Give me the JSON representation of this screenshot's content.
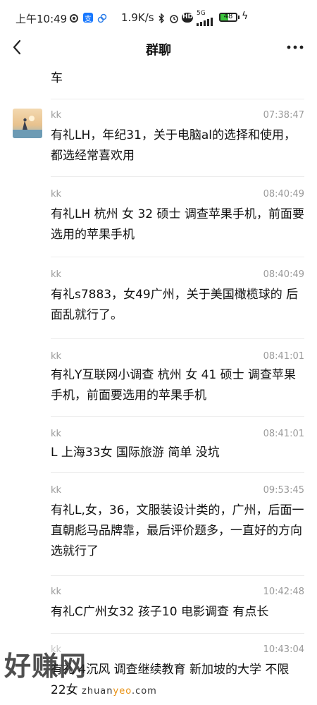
{
  "status_bar": {
    "time": "上午10:49",
    "net_speed": "1.9K/s",
    "signal": "5G",
    "hd": "HD",
    "battery": 48
  },
  "nav": {
    "title": "群聊",
    "back_icon": "chevron-left-icon",
    "more_icon": "more-dots-icon"
  },
  "previous_fragment": "车",
  "messages": [
    {
      "name": "kk",
      "time": "07:38:47",
      "text": "有礼LH，年纪31，关于电脑al的选择和使用，都选经常喜欢用",
      "avatar": true
    },
    {
      "name": "kk",
      "time": "08:40:49",
      "text": "有礼LH 杭州 女 32 硕士 调查苹果手机，前面要选用的苹果手机",
      "avatar": false
    },
    {
      "name": "kk",
      "time": "08:40:49",
      "text": "有礼s7883，女49广州，关于美国橄榄球的 后面乱就行了。",
      "avatar": false
    },
    {
      "name": "kk",
      "time": "08:41:01",
      "text": "有礼Y互联网小调查  杭州 女 41  硕士 调查苹果手机，前面要选用的苹果手机",
      "avatar": false
    },
    {
      "name": "kk",
      "time": "08:41:01",
      "text": "L 上海33女 国际旅游 简单 没坑",
      "avatar": false
    },
    {
      "name": "kk",
      "time": "09:53:45",
      "text": "有礼L,女，36，文服装设计类的，广州，后面一直朝彪马品牌靠，最后评价题多，一直好的方向选就行了",
      "avatar": false
    },
    {
      "name": "kk",
      "time": "10:42:48",
      "text": "有礼C广州女32 孩子10 电影调查  有点长",
      "avatar": false
    },
    {
      "name": "kk",
      "time": "10:43:04",
      "text": "有礼 4沉风 调查继续教育 新加坡的大学 不限 22女",
      "avatar": false
    }
  ],
  "watermark": {
    "big": "好赚网",
    "url_prefix": "zhuan",
    "url_highlight": "yeo",
    "url_suffix": ".com"
  }
}
